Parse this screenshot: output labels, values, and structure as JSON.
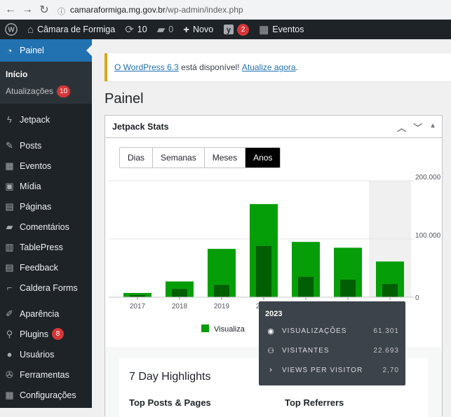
{
  "browser": {
    "url_host": "camaraformiga.mg.gov.br",
    "url_path": "/wp-admin/index.php"
  },
  "adminbar": {
    "site_name": "Câmara de Formiga",
    "updates_count": "10",
    "comments_count": "0",
    "new_label": "Novo",
    "yoast_count": "2",
    "events_label": "Eventos"
  },
  "sidebar": {
    "current": "Painel",
    "sub_inicio": "Início",
    "sub_atualizacoes": "Atualizações",
    "sub_atualizacoes_count": "10",
    "items": [
      {
        "label": "Jetpack",
        "icon": "jetpack-icon"
      },
      {
        "label": "Posts",
        "icon": "pin-icon"
      },
      {
        "label": "Eventos",
        "icon": "calendar-icon"
      },
      {
        "label": "Mídia",
        "icon": "media-icon"
      },
      {
        "label": "Páginas",
        "icon": "pages-icon"
      },
      {
        "label": "Comentários",
        "icon": "comment-icon"
      },
      {
        "label": "TablePress",
        "icon": "table-icon"
      },
      {
        "label": "Feedback",
        "icon": "feedback-icon"
      },
      {
        "label": "Caldera Forms",
        "icon": "caldera-icon"
      },
      {
        "label": "Aparência",
        "icon": "brush-icon"
      },
      {
        "label": "Plugins",
        "icon": "plug-icon",
        "badge": "8"
      },
      {
        "label": "Usuários",
        "icon": "user-icon"
      },
      {
        "label": "Ferramentas",
        "icon": "wrench-icon"
      },
      {
        "label": "Configurações",
        "icon": "settings-icon"
      }
    ]
  },
  "notice": {
    "link1": "O WordPress 6.3",
    "text": " está disponível! ",
    "link2": "Atualize agora",
    "end": "."
  },
  "page_title": "Painel",
  "widget": {
    "title": "Jetpack Stats",
    "periods": [
      "Dias",
      "Semanas",
      "Meses",
      "Anos"
    ],
    "active_period": "Anos"
  },
  "chart_data": {
    "type": "bar",
    "categories": [
      "2017",
      "2018",
      "2019",
      "2020",
      "2021",
      "2022",
      "2023"
    ],
    "series": [
      {
        "name": "Visualizações",
        "values": [
          7200,
          27000,
          83000,
          160000,
          95000,
          85000,
          61301
        ]
      },
      {
        "name": "Visitantes",
        "values": [
          3500,
          14000,
          21000,
          88000,
          35000,
          30000,
          22693
        ]
      }
    ],
    "yticks": [
      "0",
      "100.000",
      "200.000"
    ],
    "ylim": [
      0,
      200000
    ],
    "colors": {
      "views": "#069e08",
      "visitors": "#005e03",
      "highlight": "#f0f0f1"
    },
    "highlighted_category": "2023",
    "legend_label": "Visualiza"
  },
  "tooltip": {
    "year": "2023",
    "rows": [
      {
        "label": "VISUALIZAÇÕES",
        "value": "61.301",
        "icon": "eye-icon"
      },
      {
        "label": "VISITANTES",
        "value": "22.693",
        "icon": "people-icon"
      },
      {
        "label": "VIEWS PER VISITOR",
        "value": "2,70",
        "icon": "chevron-right-icon"
      }
    ]
  },
  "highlights": {
    "title": "7 Day Highlights",
    "left": "Top Posts & Pages",
    "right": "Top Referrers"
  }
}
